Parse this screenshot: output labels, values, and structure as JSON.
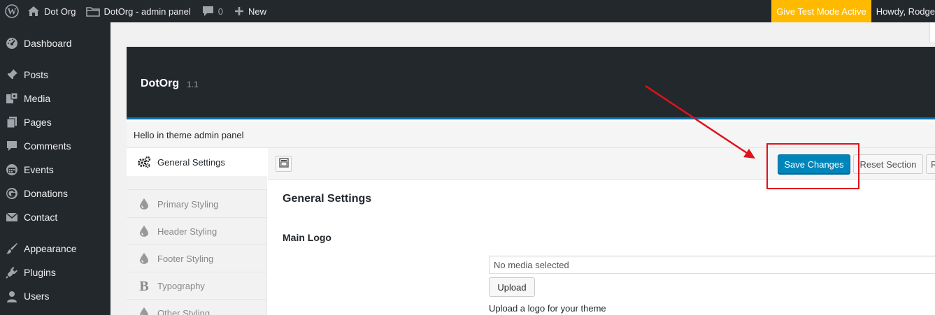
{
  "admin_bar": {
    "wp_logo": "wordpress-icon",
    "site_name": "Dot Org",
    "admin_panel_link": "DotOrg - admin panel",
    "comments_count": "0",
    "new_label": "New",
    "give_test_mode": "Give Test Mode Active",
    "howdy": "Howdy, Rodge",
    "colors": {
      "background": "#23282d",
      "give_badge": "#ffba00"
    }
  },
  "sidebar": {
    "items": [
      {
        "label": "Dashboard",
        "icon": "dashboard-icon"
      },
      {
        "label": "Posts",
        "icon": "pushpin-icon"
      },
      {
        "label": "Media",
        "icon": "media-icon"
      },
      {
        "label": "Pages",
        "icon": "pages-icon"
      },
      {
        "label": "Comments",
        "icon": "comment-icon"
      },
      {
        "label": "Events",
        "icon": "calendar-icon"
      },
      {
        "label": "Donations",
        "icon": "give-icon"
      },
      {
        "label": "Contact",
        "icon": "envelope-icon"
      },
      {
        "label": "Appearance",
        "icon": "paintbrush-icon"
      },
      {
        "label": "Plugins",
        "icon": "plugin-icon"
      },
      {
        "label": "Users",
        "icon": "user-icon"
      }
    ]
  },
  "panel": {
    "theme_name": "DotOrg",
    "theme_version": "1.1",
    "intro": "Hello in theme admin panel",
    "colors": {
      "header": "#23282d",
      "accent": "#0073aa"
    }
  },
  "sections": {
    "items": [
      {
        "label": "General Settings",
        "icon": "gears-icon",
        "active": true
      },
      {
        "label": "Primary Styling",
        "icon": "droplet-icon"
      },
      {
        "label": "Header Styling",
        "icon": "droplet-icon"
      },
      {
        "label": "Footer Styling",
        "icon": "droplet-icon"
      },
      {
        "label": "Typography",
        "icon": "bold-b-icon"
      },
      {
        "label": "Other Styling",
        "icon": "droplet-icon"
      }
    ]
  },
  "toolbar": {
    "expand_icon": "expand-icon",
    "save_label": "Save Changes",
    "reset_section_label": "Reset Section",
    "reset_all_label": "R",
    "save_color": "#0085ba"
  },
  "main": {
    "section_title": "General Settings",
    "field_label": "Main Logo",
    "media_placeholder": "No media selected",
    "upload_label": "Upload",
    "field_description": "Upload a logo for your theme"
  },
  "annotation": {
    "color": "#e0121a"
  }
}
